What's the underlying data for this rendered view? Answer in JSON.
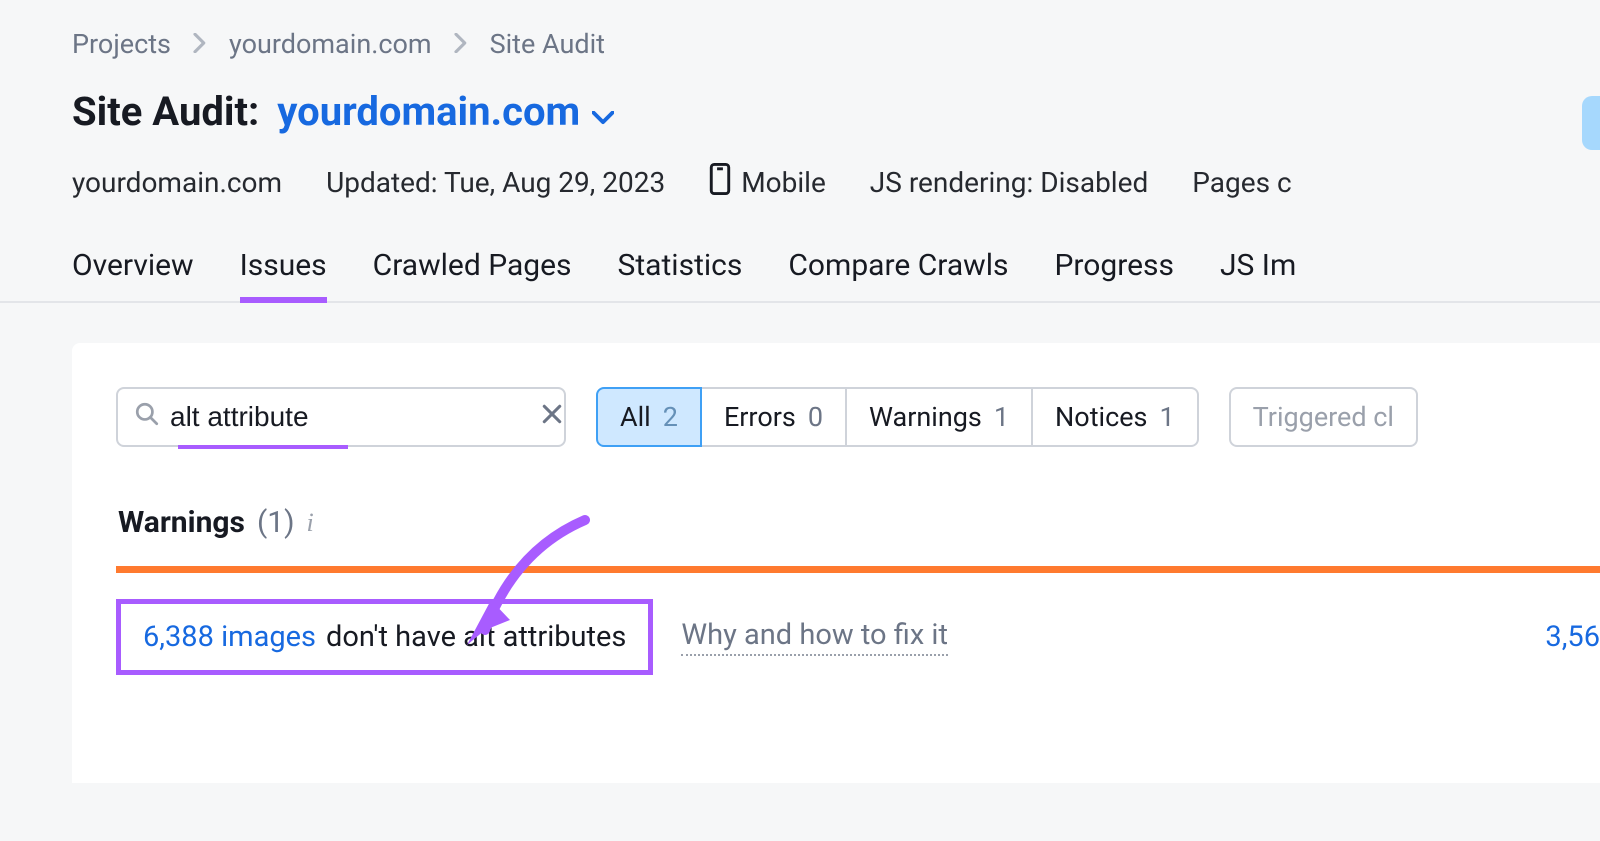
{
  "breadcrumb": {
    "items": [
      "Projects",
      "yourdomain.com",
      "Site Audit"
    ]
  },
  "title": {
    "prefix": "Site Audit:",
    "domain": "yourdomain.com"
  },
  "meta": {
    "domain": "yourdomain.com",
    "updated": "Updated: Tue, Aug 29, 2023",
    "device": "Mobile",
    "js": "JS rendering: Disabled",
    "pages": "Pages c"
  },
  "tabs": {
    "items": [
      "Overview",
      "Issues",
      "Crawled Pages",
      "Statistics",
      "Compare Crawls",
      "Progress",
      "JS Im"
    ],
    "active_index": 1
  },
  "search": {
    "value": "alt attribute"
  },
  "filters": {
    "all": {
      "label": "All",
      "count": "2"
    },
    "errors": {
      "label": "Errors",
      "count": "0"
    },
    "warnings": {
      "label": "Warnings",
      "count": "1"
    },
    "notices": {
      "label": "Notices",
      "count": "1"
    },
    "triggered": "Triggered cl"
  },
  "section": {
    "label": "Warnings",
    "count": "(1)"
  },
  "issue": {
    "count": "6,388 images",
    "text": "don't have alt attributes",
    "fix_link": "Why and how to fix it",
    "row_value": "3,56"
  }
}
